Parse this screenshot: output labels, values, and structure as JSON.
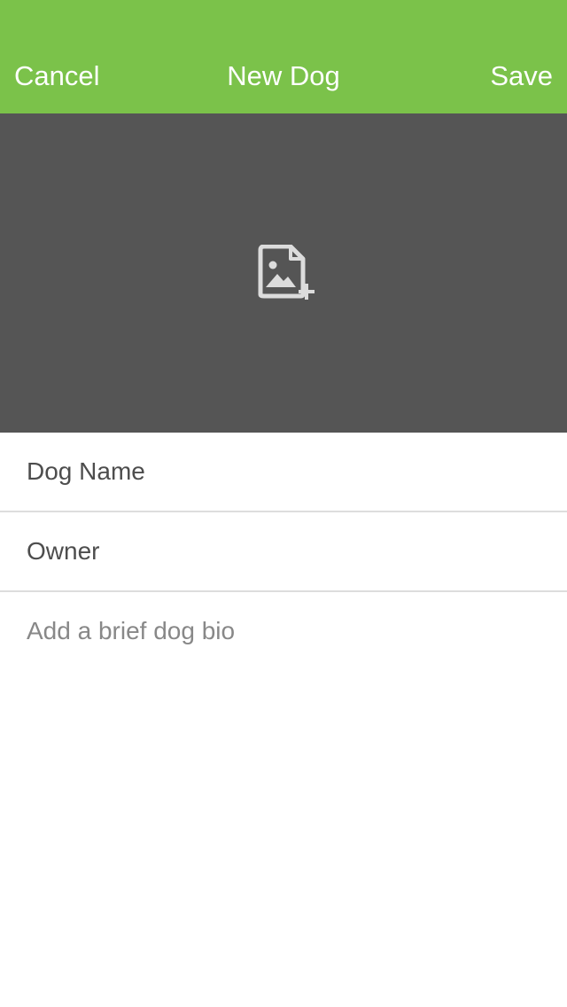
{
  "navbar": {
    "cancel_label": "Cancel",
    "title": "New Dog",
    "save_label": "Save",
    "background_color": "#7bc24a"
  },
  "photo": {
    "icon": "add-image-icon",
    "background_color": "#555555"
  },
  "form": {
    "dog_name_placeholder": "Dog Name",
    "owner_placeholder": "Owner",
    "bio_placeholder": "Add a brief dog bio"
  }
}
